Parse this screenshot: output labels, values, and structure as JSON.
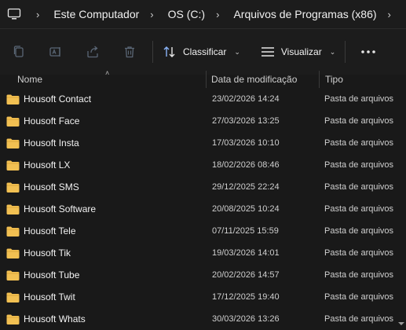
{
  "breadcrumb": {
    "items": [
      "Este Computador",
      "OS (C:)",
      "Arquivos de Programas (x86)"
    ]
  },
  "toolbar": {
    "sort_label": "Classificar",
    "view_label": "Visualizar"
  },
  "columns": {
    "name": "Nome",
    "date": "Data de modificação",
    "type": "Tipo"
  },
  "rows": [
    {
      "name": "Housoft Contact",
      "date": "23/02/2026 14:24",
      "type": "Pasta de arquivos"
    },
    {
      "name": "Housoft Face",
      "date": "27/03/2026 13:25",
      "type": "Pasta de arquivos"
    },
    {
      "name": "Housoft Insta",
      "date": "17/03/2026 10:10",
      "type": "Pasta de arquivos"
    },
    {
      "name": "Housoft LX",
      "date": "18/02/2026 08:46",
      "type": "Pasta de arquivos"
    },
    {
      "name": "Housoft SMS",
      "date": "29/12/2025 22:24",
      "type": "Pasta de arquivos"
    },
    {
      "name": "Housoft Software",
      "date": "20/08/2025 10:24",
      "type": "Pasta de arquivos"
    },
    {
      "name": "Housoft Tele",
      "date": "07/11/2025 15:59",
      "type": "Pasta de arquivos"
    },
    {
      "name": "Housoft Tik",
      "date": "19/03/2026 14:01",
      "type": "Pasta de arquivos"
    },
    {
      "name": "Housoft Tube",
      "date": "20/02/2026 14:57",
      "type": "Pasta de arquivos"
    },
    {
      "name": "Housoft Twit",
      "date": "17/12/2025 19:40",
      "type": "Pasta de arquivos"
    },
    {
      "name": "Housoft Whats",
      "date": "30/03/2026 13:26",
      "type": "Pasta de arquivos"
    }
  ],
  "colors": {
    "background": "#191919",
    "folder": "#f2c052"
  }
}
